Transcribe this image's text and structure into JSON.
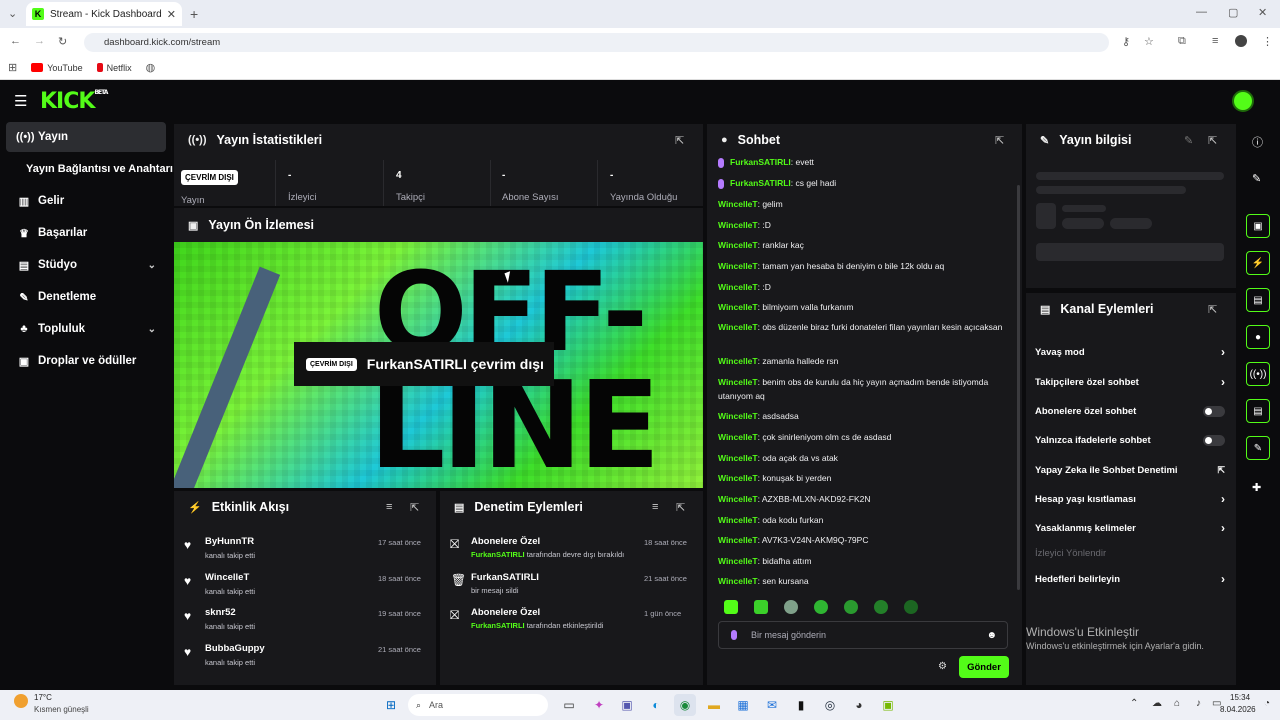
{
  "browser": {
    "tab_title": "Stream - Kick Dashboard",
    "url": "dashboard.kick.com/stream",
    "bookmarks": [
      "YouTube",
      "Netflix"
    ]
  },
  "header": {
    "logo": "KICK",
    "logo_badge": "BETA"
  },
  "sidebar": {
    "items": [
      {
        "label": "Yayın",
        "icon": "broadcast-icon"
      },
      {
        "label": "Yayın Bağlantısı ve Anahtarı",
        "icon": ""
      },
      {
        "label": "Gelir",
        "icon": "chart-icon"
      },
      {
        "label": "Başarılar",
        "icon": "trophy-icon"
      },
      {
        "label": "Stüdyo",
        "icon": "studio-icon"
      },
      {
        "label": "Denetleme",
        "icon": "wrench-icon"
      },
      {
        "label": "Topluluk",
        "icon": "community-icon"
      },
      {
        "label": "Droplar ve ödüller",
        "icon": "drops-icon"
      }
    ]
  },
  "stats": {
    "title": "Yayın İstatistikleri",
    "status_badge": "ÇEVRİM DIŞI",
    "items": [
      {
        "value": "",
        "label": "Yayın"
      },
      {
        "value": "-",
        "label": "İzleyici"
      },
      {
        "value": "4",
        "label": "Takipçi"
      },
      {
        "value": "-",
        "label": "Abone Sayısı"
      },
      {
        "value": "-",
        "label": "Yayında Olduğu"
      }
    ]
  },
  "preview": {
    "title": "Yayın Ön İzlemesi",
    "badge": "ÇEVRİM DIŞI",
    "message": "FurkanSATIRLI çevrim dışı",
    "bg_text_1": "OFF-",
    "bg_text_2": "LINE"
  },
  "activity": {
    "title": "Etkinlik Akışı",
    "items": [
      {
        "name": "ByHunnTR",
        "sub": "kanalı takip etti",
        "time": "17 saat önce"
      },
      {
        "name": "WincelleT",
        "sub": "kanalı takip etti",
        "time": "18 saat önce"
      },
      {
        "name": "sknr52",
        "sub": "kanalı takip etti",
        "time": "19 saat önce"
      },
      {
        "name": "BubbaGuppy",
        "sub": "kanalı takip etti",
        "time": "21 saat önce"
      }
    ]
  },
  "moderation": {
    "title": "Denetim Eylemleri",
    "items": [
      {
        "name": "Abonelere Özel",
        "user": "FurkanSATIRLI",
        "sub": " tarafından devre dışı bırakıldı",
        "time": "18 saat önce"
      },
      {
        "name": "FurkanSATIRLI",
        "user": "",
        "sub": "bir mesajı sildi",
        "time": "21 saat önce"
      },
      {
        "name": "Abonelere Özel",
        "user": "FurkanSATIRLI",
        "sub": " tarafından etkinleştirildi",
        "time": "1 gün önce"
      }
    ]
  },
  "chat": {
    "title": "Sohbet",
    "messages": [
      {
        "user": "FurkanSATIRLI",
        "text": ": evett",
        "mic": true
      },
      {
        "user": "FurkanSATIRLI",
        "text": ": cs gel hadi",
        "mic": true
      },
      {
        "user": "WincelleT",
        "text": ": gelim"
      },
      {
        "user": "WincelleT",
        "text": ": :D"
      },
      {
        "user": "WincelleT",
        "text": ": ranklar kaç"
      },
      {
        "user": "WincelleT",
        "text": ": tamam yan hesaba bi deniyim o bile 12k oldu aq"
      },
      {
        "user": "WincelleT",
        "text": ": :D"
      },
      {
        "user": "WincelleT",
        "text": ": bilmiyoım valla furkanım"
      },
      {
        "user": "WincelleT",
        "text": ": obs düzenle biraz furki donateleri filan yayınları kesin açıcaksan"
      },
      {
        "user": "WincelleT",
        "text": ": zamanla hallede rsn"
      },
      {
        "user": "WincelleT",
        "text": ": benim obs de kurulu da hiç yayın açmadım bende istiyomda utanıyom aq"
      },
      {
        "user": "WincelleT",
        "text": ": asdsadsa"
      },
      {
        "user": "WincelleT",
        "text": ": çok sinirleniyom olm cs de asdasd"
      },
      {
        "user": "WincelleT",
        "text": ": oda açak da vs atak"
      },
      {
        "user": "WincelleT",
        "text": ": konuşak bi yerden"
      },
      {
        "user": "WincelleT",
        "text": ": AZXBB-MLXN-AKD92-FK2N"
      },
      {
        "user": "WincelleT",
        "text": ": oda kodu furkan"
      },
      {
        "user": "WincelleT",
        "text": ": AV7K3-V24N-AKM9Q-79PC"
      },
      {
        "user": "WincelleT",
        "text": ": bidafha attım"
      },
      {
        "user": "WincelleT",
        "text": ": sen kursana"
      }
    ],
    "input_placeholder": "Bir mesaj gönderin",
    "send_label": "Gönder"
  },
  "stream_info": {
    "title": "Yayın bilgisi"
  },
  "channel_actions": {
    "title": "Kanal Eylemleri",
    "items": [
      {
        "label": "Yavaş mod",
        "control": "arrow"
      },
      {
        "label": "Takipçilere özel sohbet",
        "control": "arrow"
      },
      {
        "label": "Abonelere özel sohbet",
        "control": "toggle"
      },
      {
        "label": "Yalnızca ifadelerle sohbet",
        "control": "toggle"
      },
      {
        "label": "Yapay Zeka ile Sohbet Denetimi",
        "control": "external"
      },
      {
        "label": "Hesap yaşı kısıtlaması",
        "control": "arrow"
      },
      {
        "label": "Yasaklanmış kelimeler",
        "control": "arrow"
      },
      {
        "label": "İzleyici Yönlendir",
        "control": "none"
      },
      {
        "label": "Hedefleri belirleyin",
        "control": "arrow"
      }
    ]
  },
  "windows_watermark": {
    "title": "Windows'u Etkinleştir",
    "sub": "Windows'u etkinleştirmek için Ayarlar'a gidin."
  },
  "taskbar": {
    "weather_temp": "17°C",
    "weather_desc": "Kısmen güneşli",
    "search": "Ara",
    "time": "15:34",
    "date": "8.04.2026"
  },
  "colors": {
    "accent": "#53fc18",
    "panel": "#18181b",
    "bg": "#0b0b0d"
  }
}
